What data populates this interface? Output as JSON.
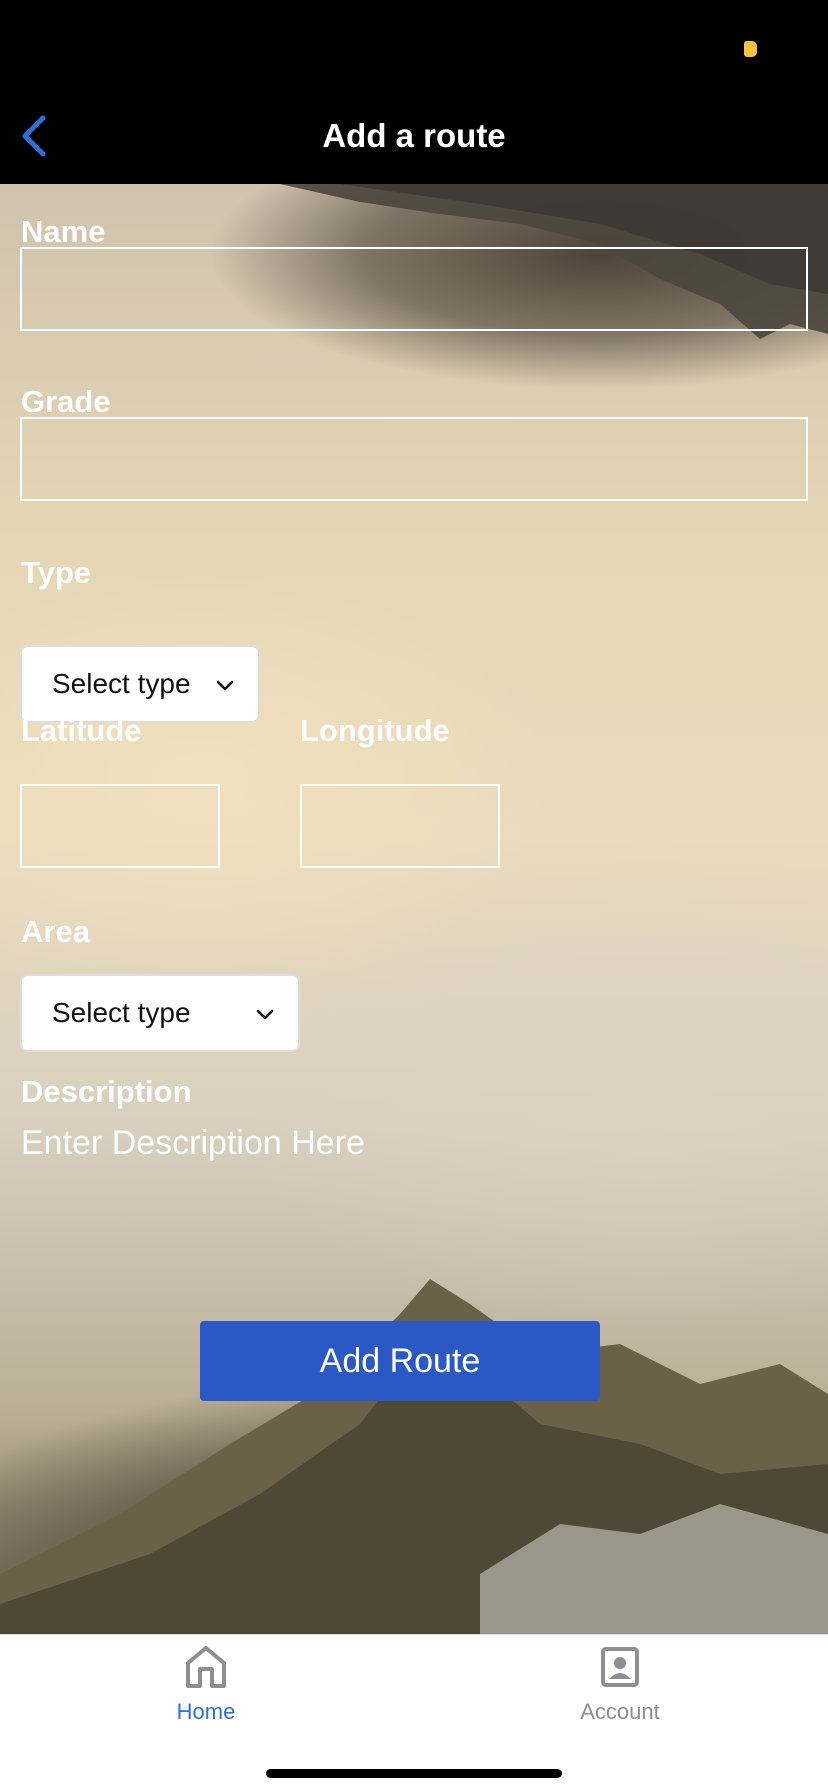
{
  "nav": {
    "title": "Add a route",
    "back_icon": "chevron-left-icon"
  },
  "form": {
    "name_label": "Name",
    "name_value": "",
    "grade_label": "Grade",
    "grade_value": "",
    "type_label": "Type",
    "type_select_text": "Select type",
    "latitude_label": "Latitude",
    "latitude_value": "",
    "longitude_label": "Longitude",
    "longitude_value": "",
    "area_label": "Area",
    "area_select_text": "Select type",
    "description_label": "Description",
    "description_placeholder": "Enter Description Here",
    "submit_label": "Add Route"
  },
  "tabs": [
    {
      "label": "Home",
      "icon": "home-icon",
      "active": true
    },
    {
      "label": "Account",
      "icon": "account-icon",
      "active": false
    }
  ],
  "colors": {
    "accent": "#2a59c5",
    "tab_active": "#2f6fd8",
    "tab_inactive": "#8e8e93",
    "back_icon": "#2f6fd8"
  }
}
